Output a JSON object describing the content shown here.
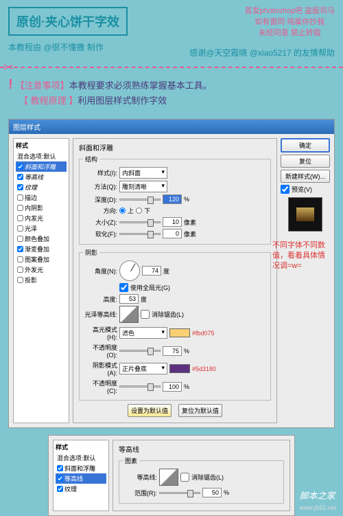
{
  "header": {
    "title": "原创·夹心饼干字效",
    "pink_lines": "首发photoshop吧 盗版司马\n如有雷同 纯属你抄我\n未经同意 禁止转载",
    "credit_left": "本教程由 @很不懂撒 制作",
    "credit_right": "感谢@天空霞晓 @xiao5217 的友情帮助"
  },
  "notice": {
    "line1_label": "【注意事项】",
    "line1_text": "本教程要求必须熟练掌握基本工具。",
    "line2_label": "【 教程原理 】",
    "line2_text": "利用图层样式制作字效"
  },
  "dialog": {
    "title": "图层样式",
    "styles_hdr": "样式",
    "blend": "混合选项:默认",
    "items": [
      "斜面和浮雕",
      "等高线",
      "纹理",
      "描边",
      "内阴影",
      "内发光",
      "光泽",
      "颜色叠加",
      "渐变叠加",
      "图案叠加",
      "外发光",
      "投影"
    ],
    "checked": [
      true,
      true,
      true,
      false,
      false,
      false,
      false,
      false,
      true,
      false,
      false,
      false
    ],
    "selected_index": 0,
    "mid_title": "斜面和浮雕",
    "struct": {
      "legend": "结构",
      "style_lbl": "样式(I):",
      "style_val": "内斜面",
      "method_lbl": "方法(Q):",
      "method_val": "雕刻清晰",
      "depth_lbl": "深度(D):",
      "depth_val": "120",
      "depth_unit": "%",
      "dir_lbl": "方向:",
      "dir_up": "上",
      "dir_down": "下",
      "size_lbl": "大小(Z):",
      "size_val": "10",
      "size_unit": "像素",
      "soft_lbl": "软化(F):",
      "soft_val": "0",
      "soft_unit": "像素"
    },
    "shade": {
      "legend": "阴影",
      "angle_lbl": "角度(N):",
      "angle_val": "74",
      "angle_unit": "度",
      "global": "使用全局光(G)",
      "alt_lbl": "高度:",
      "alt_val": "53",
      "alt_unit": "度",
      "gloss_lbl": "光泽等高线:",
      "anti": "消除锯齿(L)",
      "hilite_lbl": "高光模式(H):",
      "hilite_val": "滤色",
      "hilite_hex": "#fbd075",
      "hopac_lbl": "不透明度(O):",
      "hopac_val": "75",
      "hopac_unit": "%",
      "shadow_lbl": "阴影模式(A):",
      "shadow_val": "正片叠底",
      "shadow_hex": "#5d3180",
      "sopac_lbl": "不透明度(C):",
      "sopac_val": "100",
      "sopac_unit": "%"
    },
    "btn_default": "设置为默认值",
    "btn_reset": "复位为默认值",
    "right": {
      "ok": "确定",
      "cancel": "复位",
      "new": "新建样式(W)...",
      "preview": "预览(V)"
    }
  },
  "red_note": "不同字体不同数值，看着具体情况调=w=",
  "dialog2": {
    "mid_title": "等高线",
    "legend": "图素",
    "contour_lbl": "等高线:",
    "anti": "消除锯齿(L)",
    "range_lbl": "范围(R):",
    "range_val": "50",
    "range_unit": "%"
  },
  "watermark": {
    "main": "脚本之家",
    "sub": "www.jb51.net"
  }
}
